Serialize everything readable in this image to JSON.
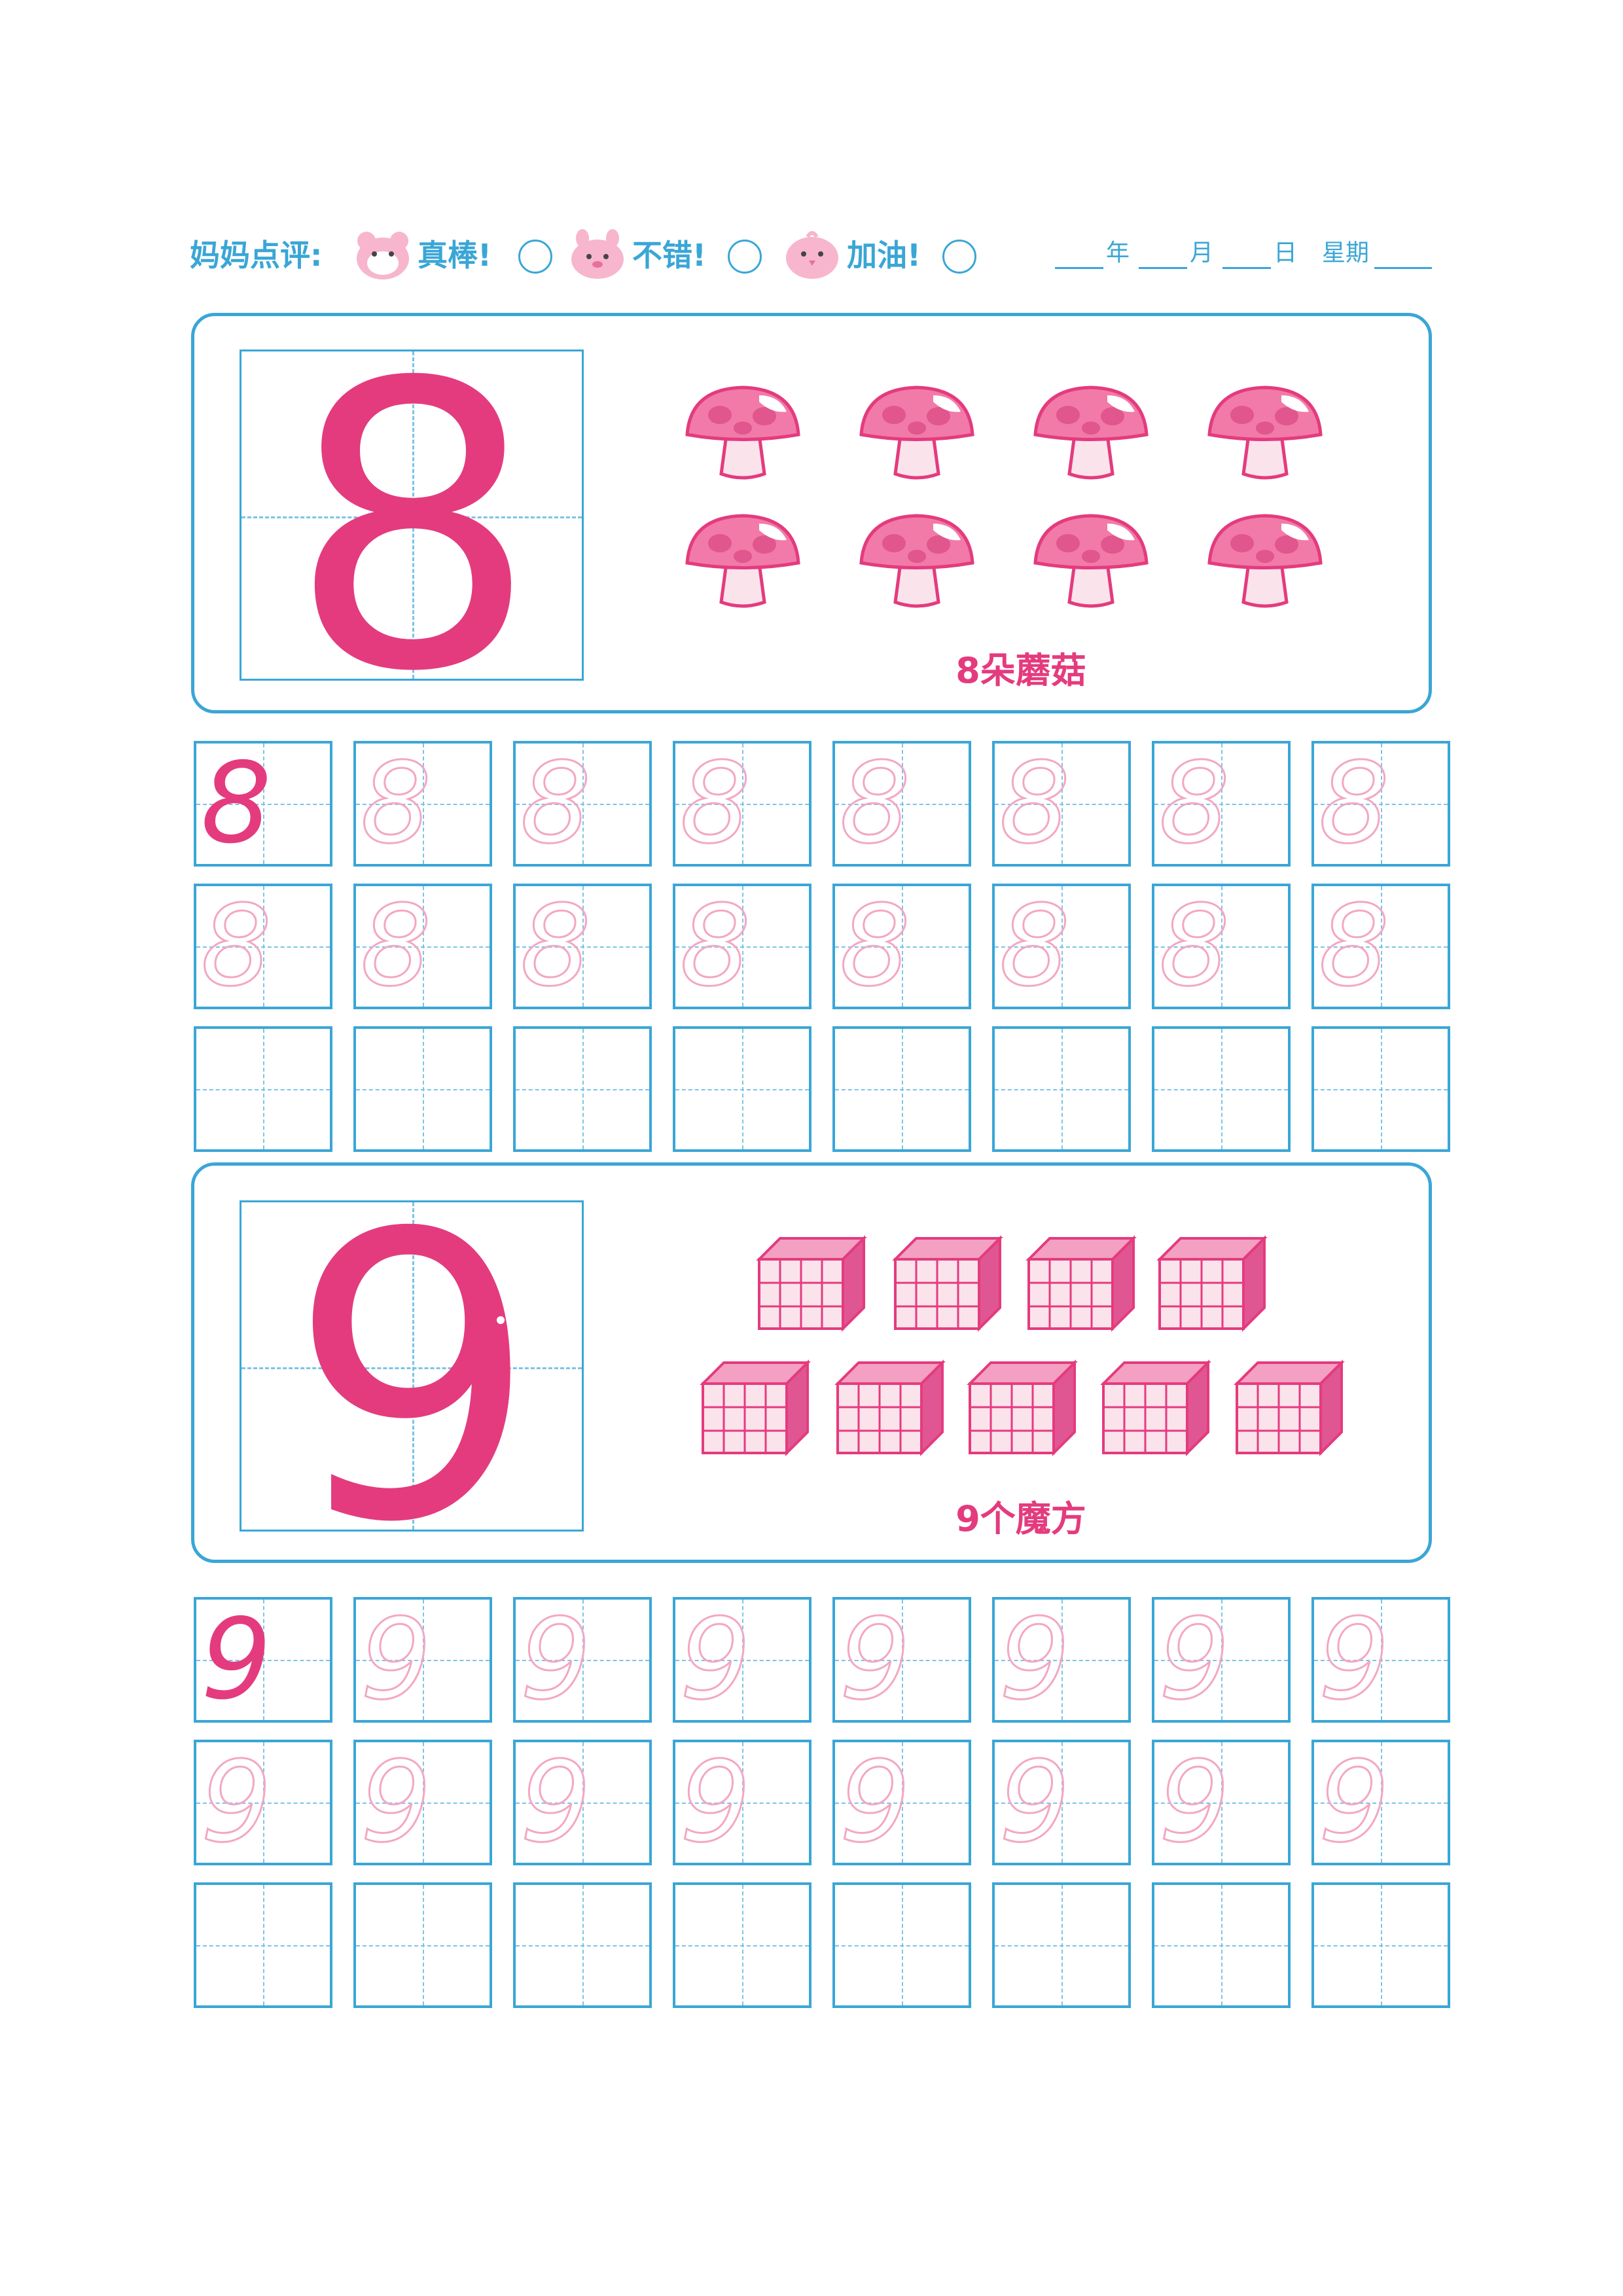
{
  "header": {
    "review_label": "妈妈点评:",
    "options": [
      "真棒!",
      "不错!",
      "加油!"
    ],
    "date": {
      "year": "年",
      "month": "月",
      "day": "日",
      "week": "星期"
    }
  },
  "sections": [
    {
      "digit": "8",
      "caption": "8朵蘑菇",
      "object": "mushroom-icon",
      "count": 8
    },
    {
      "digit": "9",
      "caption": "9个魔方",
      "object": "cube-icon",
      "count": 9
    }
  ],
  "colors": {
    "pink": "#e43b7e",
    "light_pink": "#f3a7c4",
    "blue": "#3aa6d6"
  }
}
